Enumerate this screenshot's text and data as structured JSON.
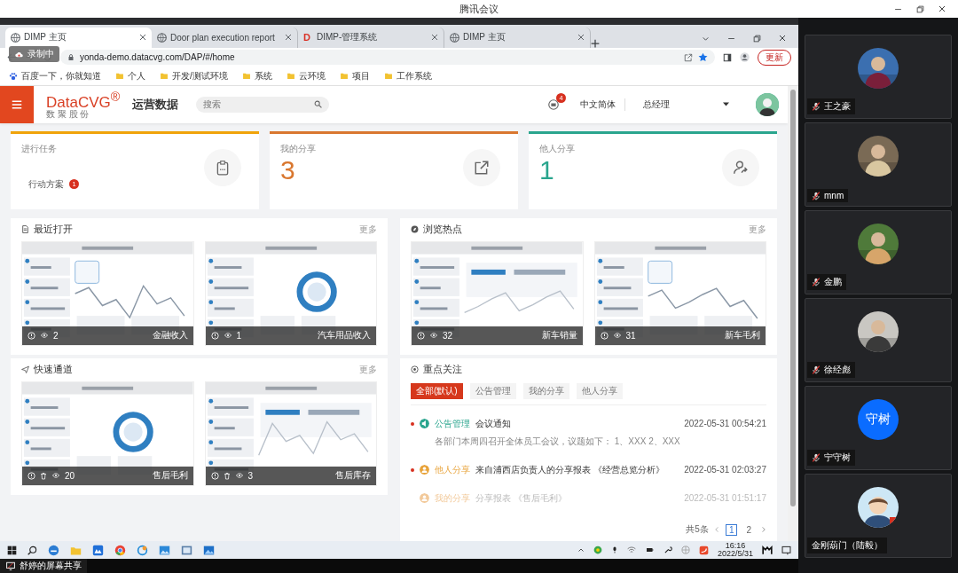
{
  "meeting": {
    "title": "腾讯会议",
    "recording_badge": "录制中",
    "share_label": "舒婷的屏幕共享"
  },
  "browser": {
    "tabs": [
      {
        "title": "DIMP 主页",
        "selected": true,
        "kind": "globe"
      },
      {
        "title": "Door plan execution report",
        "selected": false,
        "kind": "globe"
      },
      {
        "title": "DIMP-管理系统",
        "selected": false,
        "kind": "letter",
        "favicon": "D"
      },
      {
        "title": "DIMP 主页",
        "selected": false,
        "kind": "globe"
      }
    ],
    "url": "yonda-demo.datacvg.com/DAP/#/home",
    "update_button": "更新",
    "bookmarks": [
      {
        "label": "百度一下，你就知道",
        "kind": "baidu"
      },
      {
        "label": "个人",
        "kind": "folder"
      },
      {
        "label": "开发/测试环境",
        "kind": "folder"
      },
      {
        "label": "系统",
        "kind": "folder"
      },
      {
        "label": "云环境",
        "kind": "folder"
      },
      {
        "label": "项目",
        "kind": "folder"
      },
      {
        "label": "工作系统",
        "kind": "folder"
      }
    ]
  },
  "app": {
    "logo": "DataCVG$^{®}$",
    "logo_sub": "数 聚 股 份",
    "title": "运营数据",
    "search_placeholder": "搜索",
    "message_badge": "4",
    "language": "中文简体",
    "role": "总经理"
  },
  "cards": [
    {
      "kind": "tasks",
      "title": "进行任务",
      "color": "#f0a30a",
      "item": "行动方案",
      "badge": "1"
    },
    {
      "kind": "shared_out",
      "title": "我的分享",
      "color": "#d9772f",
      "value": "3"
    },
    {
      "kind": "shared_in",
      "title": "他人分享",
      "color": "#2aa58e",
      "value": "1"
    }
  ],
  "sections": [
    {
      "kind": "recent",
      "title": "最近打开",
      "more": "更多",
      "thumbnails": [
        {
          "views": "2",
          "name": "金融收入",
          "deletable": false
        },
        {
          "views": "1",
          "name": "汽车用品收入",
          "deletable": false
        }
      ]
    },
    {
      "kind": "hot",
      "title": "浏览热点",
      "more": "更多",
      "thumbnails": [
        {
          "views": "32",
          "name": "新车销量",
          "deletable": false
        },
        {
          "views": "31",
          "name": "新车毛利",
          "deletable": false
        }
      ]
    },
    {
      "kind": "quick",
      "title": "快速通道",
      "more": "更多",
      "thumbnails": [
        {
          "views": "20",
          "name": "售后毛利",
          "deletable": true
        },
        {
          "views": "3",
          "name": "售后库存",
          "deletable": true
        }
      ]
    }
  ],
  "focus": {
    "title": "重点关注",
    "tabs": [
      {
        "label": "全部(默认)",
        "selected": true
      },
      {
        "label": "公告管理",
        "selected": false
      },
      {
        "label": "我的分享",
        "selected": false
      },
      {
        "label": "他人分享",
        "selected": false
      }
    ],
    "items": [
      {
        "kind": "notice",
        "category": "公告管理",
        "title": "会议通知",
        "time": "2022-05-31 00:54:21",
        "description": "各部门本周四召开全体员工会议，议题如下： 1、XXX 2、XXX",
        "unread": true,
        "color": "#2aa58e"
      },
      {
        "kind": "share",
        "category": "他人分享",
        "title": "来自浦西店负责人的分享报表 《经营总览分析》",
        "time": "2022-05-31 02:03:27",
        "unread": true,
        "color": "#e8a33a"
      },
      {
        "kind": "share",
        "category": "我的分享",
        "title": "分享报表 《售后毛利》",
        "time": "2022-05-31 01:51:17",
        "unread": false,
        "color": "#f2c99a"
      }
    ],
    "pagination": {
      "total": "共5条",
      "pages": [
        {
          "label": "1",
          "selected": true
        },
        {
          "label": "2",
          "selected": false
        }
      ]
    }
  },
  "taskbar": {
    "time": "16:16",
    "date": "2022/5/31"
  },
  "participants": [
    {
      "name": "王之豪",
      "muted": true
    },
    {
      "name": "mnm",
      "muted": true
    },
    {
      "name": "金鹏",
      "muted": true
    },
    {
      "name": "徐经彪",
      "muted": true
    },
    {
      "name": "宁守树",
      "kind": "initials",
      "initials": "守树",
      "muted": true
    },
    {
      "name": "金刚葫门（陆毅）",
      "kind": "cartoon",
      "muted": false
    }
  ]
}
